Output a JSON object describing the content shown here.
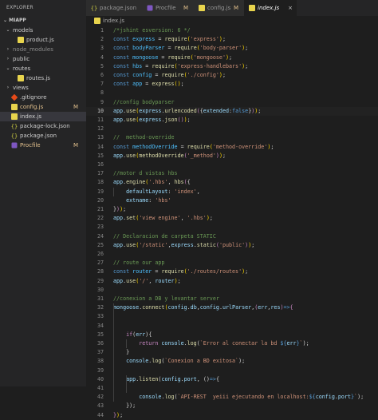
{
  "explorer": {
    "header": "EXPLORER",
    "section": "MIAPP",
    "items": [
      {
        "label": "models",
        "kind": "folder",
        "open": true,
        "depth": 0,
        "icon": "folder-icon"
      },
      {
        "label": "product.js",
        "kind": "js",
        "depth": 1
      },
      {
        "label": "node_modules",
        "kind": "folder",
        "open": false,
        "depth": 0,
        "dim": true
      },
      {
        "label": "public",
        "kind": "folder",
        "open": false,
        "depth": 0
      },
      {
        "label": "routes",
        "kind": "folder",
        "open": true,
        "depth": 0
      },
      {
        "label": "routes.js",
        "kind": "js",
        "depth": 1
      },
      {
        "label": "views",
        "kind": "folder",
        "open": false,
        "depth": 0
      },
      {
        "label": ".gitignore",
        "kind": "git",
        "depth": 0
      },
      {
        "label": "config.js",
        "kind": "js",
        "depth": 0,
        "badge": "M",
        "modified": true
      },
      {
        "label": "index.js",
        "kind": "js",
        "depth": 0,
        "active": true
      },
      {
        "label": "package-lock.json",
        "kind": "json",
        "depth": 0
      },
      {
        "label": "package.json",
        "kind": "json",
        "depth": 0
      },
      {
        "label": "Procfile",
        "kind": "heroku",
        "depth": 0,
        "badge": "M",
        "modified": true
      }
    ]
  },
  "tabs": [
    {
      "label": "package.json",
      "kind": "json",
      "badge": "",
      "active": false
    },
    {
      "label": "Procfile",
      "kind": "heroku",
      "badge": "M",
      "active": false
    },
    {
      "label": "config.js",
      "kind": "js",
      "badge": "M",
      "active": false
    },
    {
      "label": "index.js",
      "kind": "js",
      "badge": "",
      "active": true,
      "close": "×"
    }
  ],
  "breadcrumb": {
    "file": "index.js"
  },
  "editor": {
    "current_line": 10,
    "lines": [
      [
        [
          "c",
          "/*jshint esversion: 6 */"
        ]
      ],
      [
        [
          "k",
          "const "
        ],
        [
          "c1",
          "express"
        ],
        [
          "p",
          " = "
        ],
        [
          "f",
          "require"
        ],
        [
          "b",
          "("
        ],
        [
          "s",
          "'express'"
        ],
        [
          "b",
          ")"
        ],
        [
          "p",
          ";"
        ]
      ],
      [
        [
          "k",
          "const "
        ],
        [
          "c1",
          "bodyParser"
        ],
        [
          "p",
          " = "
        ],
        [
          "f",
          "require"
        ],
        [
          "b",
          "("
        ],
        [
          "s",
          "'body-parser'"
        ],
        [
          "b",
          ")"
        ],
        [
          "p",
          ";"
        ]
      ],
      [
        [
          "k",
          "const "
        ],
        [
          "c1",
          "mongoose"
        ],
        [
          "p",
          " = "
        ],
        [
          "f",
          "require"
        ],
        [
          "b",
          "("
        ],
        [
          "s",
          "'mongoose'"
        ],
        [
          "b",
          ")"
        ],
        [
          "p",
          ";"
        ]
      ],
      [
        [
          "k",
          "const "
        ],
        [
          "c1",
          "hbs"
        ],
        [
          "p",
          " = "
        ],
        [
          "f",
          "require"
        ],
        [
          "b",
          "("
        ],
        [
          "s",
          "'express-handlebars'"
        ],
        [
          "b",
          ")"
        ],
        [
          "p",
          ";"
        ]
      ],
      [
        [
          "k",
          "const "
        ],
        [
          "c1",
          "config"
        ],
        [
          "p",
          " = "
        ],
        [
          "f",
          "require"
        ],
        [
          "b",
          "("
        ],
        [
          "s",
          "'./config'"
        ],
        [
          "b",
          ")"
        ],
        [
          "p",
          ";"
        ]
      ],
      [
        [
          "k",
          "const "
        ],
        [
          "c1",
          "app"
        ],
        [
          "p",
          " = "
        ],
        [
          "f",
          "express"
        ],
        [
          "b",
          "()"
        ],
        [
          "p",
          ";"
        ]
      ],
      [],
      [
        [
          "c",
          "//config bodyparser"
        ]
      ],
      [
        [
          "v",
          "app"
        ],
        [
          "p",
          "."
        ],
        [
          "f",
          "use"
        ],
        [
          "b",
          "("
        ],
        [
          "v",
          "express"
        ],
        [
          "p",
          "."
        ],
        [
          "f",
          "urlencoded"
        ],
        [
          "ctl",
          "("
        ],
        [
          "p",
          "{"
        ],
        [
          "v",
          "extended"
        ],
        [
          "p",
          ":"
        ],
        [
          "k",
          "false"
        ],
        [
          "p",
          "}"
        ],
        [
          "ctl",
          ")"
        ],
        [
          "b",
          ")"
        ],
        [
          "p",
          ";"
        ]
      ],
      [
        [
          "v",
          "app"
        ],
        [
          "p",
          "."
        ],
        [
          "f",
          "use"
        ],
        [
          "b",
          "("
        ],
        [
          "v",
          "express"
        ],
        [
          "p",
          "."
        ],
        [
          "f",
          "json"
        ],
        [
          "ctl",
          "()"
        ],
        [
          "b",
          ")"
        ],
        [
          "p",
          ";"
        ]
      ],
      [],
      [
        [
          "c",
          "//  method-override"
        ]
      ],
      [
        [
          "k",
          "const "
        ],
        [
          "c1",
          "methodOverride"
        ],
        [
          "p",
          " = "
        ],
        [
          "f",
          "require"
        ],
        [
          "b",
          "("
        ],
        [
          "s",
          "'method-override'"
        ],
        [
          "b",
          ")"
        ],
        [
          "p",
          ";"
        ]
      ],
      [
        [
          "v",
          "app"
        ],
        [
          "p",
          "."
        ],
        [
          "f",
          "use"
        ],
        [
          "b",
          "("
        ],
        [
          "f",
          "methodOverride"
        ],
        [
          "ctl",
          "("
        ],
        [
          "s",
          "'_method'"
        ],
        [
          "ctl",
          ")"
        ],
        [
          "b",
          ")"
        ],
        [
          "p",
          ";"
        ]
      ],
      [],
      [
        [
          "c",
          "//motor d vistas hbs"
        ]
      ],
      [
        [
          "v",
          "app"
        ],
        [
          "p",
          "."
        ],
        [
          "f",
          "engine"
        ],
        [
          "b",
          "("
        ],
        [
          "s",
          "'.hbs'"
        ],
        [
          "p",
          ", "
        ],
        [
          "f",
          "hbs"
        ],
        [
          "ctl",
          "("
        ],
        [
          "p",
          "{"
        ]
      ],
      [
        [
          "p",
          "    "
        ],
        [
          "v",
          "defaultLayout"
        ],
        [
          "p",
          ": "
        ],
        [
          "s",
          "'index'"
        ],
        [
          "p",
          ","
        ]
      ],
      [
        [
          "p",
          "    "
        ],
        [
          "v",
          "extname"
        ],
        [
          "p",
          ": "
        ],
        [
          "s",
          "'hbs'"
        ]
      ],
      [
        [
          "p",
          "}"
        ],
        [
          "ctl",
          ")"
        ],
        [
          "b",
          ")"
        ],
        [
          "p",
          ";"
        ]
      ],
      [
        [
          "v",
          "app"
        ],
        [
          "p",
          "."
        ],
        [
          "f",
          "set"
        ],
        [
          "b",
          "("
        ],
        [
          "s",
          "'view engine'"
        ],
        [
          "p",
          ", "
        ],
        [
          "s",
          "'.hbs'"
        ],
        [
          "b",
          ")"
        ],
        [
          "p",
          ";"
        ]
      ],
      [],
      [
        [
          "c",
          "// Declaracion de carpeta STATIC"
        ]
      ],
      [
        [
          "v",
          "app"
        ],
        [
          "p",
          "."
        ],
        [
          "f",
          "use"
        ],
        [
          "b",
          "("
        ],
        [
          "s",
          "'/static'"
        ],
        [
          "p",
          ","
        ],
        [
          "v",
          "express"
        ],
        [
          "p",
          "."
        ],
        [
          "f",
          "static"
        ],
        [
          "ctl",
          "("
        ],
        [
          "s",
          "'public'"
        ],
        [
          "ctl",
          ")"
        ],
        [
          "b",
          ")"
        ],
        [
          "p",
          ";"
        ]
      ],
      [],
      [
        [
          "c",
          "// route our app"
        ]
      ],
      [
        [
          "k",
          "const "
        ],
        [
          "c1",
          "router"
        ],
        [
          "p",
          " = "
        ],
        [
          "f",
          "require"
        ],
        [
          "b",
          "("
        ],
        [
          "s",
          "'./routes/routes'"
        ],
        [
          "b",
          ")"
        ],
        [
          "p",
          ";"
        ]
      ],
      [
        [
          "v",
          "app"
        ],
        [
          "p",
          "."
        ],
        [
          "f",
          "use"
        ],
        [
          "b",
          "("
        ],
        [
          "s",
          "'/'"
        ],
        [
          "p",
          ", "
        ],
        [
          "v",
          "router"
        ],
        [
          "b",
          ")"
        ],
        [
          "p",
          ";"
        ]
      ],
      [],
      [
        [
          "c",
          "//conexion a DB y levantar server"
        ]
      ],
      [
        [
          "v",
          "mongoose"
        ],
        [
          "p",
          "."
        ],
        [
          "f",
          "connect"
        ],
        [
          "b",
          "("
        ],
        [
          "v",
          "config"
        ],
        [
          "p",
          "."
        ],
        [
          "v",
          "db"
        ],
        [
          "p",
          ","
        ],
        [
          "v",
          "config"
        ],
        [
          "p",
          "."
        ],
        [
          "v",
          "urlParser"
        ],
        [
          "p",
          ","
        ],
        [
          "ctl",
          "("
        ],
        [
          "v",
          "err"
        ],
        [
          "p",
          ","
        ],
        [
          "v",
          "res"
        ],
        [
          "ctl",
          ")"
        ],
        [
          "k",
          "=>"
        ],
        [
          "ctl",
          "{"
        ]
      ],
      [],
      [],
      [
        [
          "p",
          "    "
        ],
        [
          "ctl",
          "if"
        ],
        [
          "p",
          "("
        ],
        [
          "v",
          "err"
        ],
        [
          "p",
          "){"
        ]
      ],
      [
        [
          "p",
          "        "
        ],
        [
          "ctl",
          "return "
        ],
        [
          "v",
          "console"
        ],
        [
          "p",
          "."
        ],
        [
          "f",
          "log"
        ],
        [
          "p",
          "("
        ],
        [
          "s",
          "`Error al conectar la bd "
        ],
        [
          "k",
          "${"
        ],
        [
          "v",
          "err"
        ],
        [
          "k",
          "}"
        ],
        [
          "s",
          "`"
        ],
        [
          "p",
          ");"
        ]
      ],
      [
        [
          "p",
          "    }"
        ]
      ],
      [
        [
          "p",
          "    "
        ],
        [
          "v",
          "console"
        ],
        [
          "p",
          "."
        ],
        [
          "f",
          "log"
        ],
        [
          "p",
          "("
        ],
        [
          "s",
          "`Conexion a BD exitosa`"
        ],
        [
          "p",
          ");"
        ]
      ],
      [],
      [
        [
          "p",
          "    "
        ],
        [
          "v",
          "app"
        ],
        [
          "p",
          "."
        ],
        [
          "f",
          "listen"
        ],
        [
          "p",
          "("
        ],
        [
          "v",
          "config"
        ],
        [
          "p",
          "."
        ],
        [
          "v",
          "port"
        ],
        [
          "p",
          ", "
        ],
        [
          "p",
          "()"
        ],
        [
          "k",
          "=>"
        ],
        [
          "p",
          "{"
        ]
      ],
      [],
      [
        [
          "p",
          "        "
        ],
        [
          "v",
          "console"
        ],
        [
          "p",
          "."
        ],
        [
          "f",
          "log"
        ],
        [
          "p",
          "("
        ],
        [
          "s",
          "`API-REST  yeiii ejecutando en localhost:"
        ],
        [
          "k",
          "${"
        ],
        [
          "v",
          "config"
        ],
        [
          "p",
          "."
        ],
        [
          "v",
          "port"
        ],
        [
          "k",
          "}"
        ],
        [
          "s",
          "`"
        ],
        [
          "p",
          ");"
        ]
      ],
      [
        [
          "p",
          "    });"
        ]
      ],
      [
        [
          "ctl",
          "}"
        ],
        [
          "b",
          ")"
        ],
        [
          "p",
          ";"
        ]
      ]
    ]
  }
}
